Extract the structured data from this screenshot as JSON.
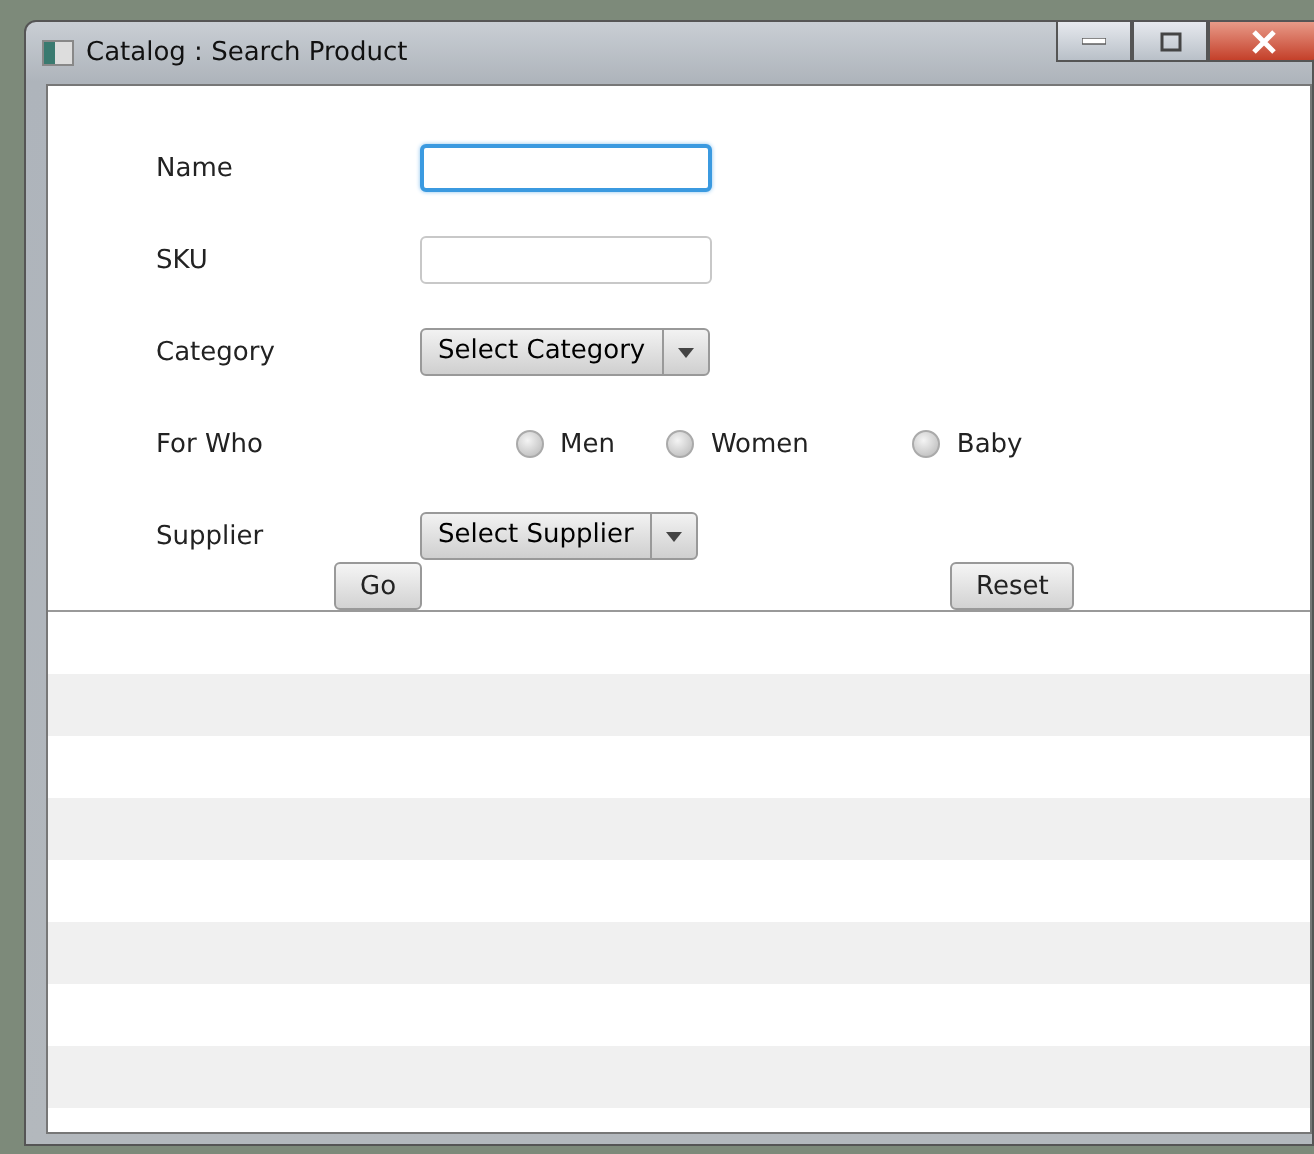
{
  "window": {
    "title": "Catalog : Search Product"
  },
  "form": {
    "name": {
      "label": "Name",
      "focused": true
    },
    "sku": {
      "label": "SKU",
      "focused": false
    },
    "category": {
      "label": "Category",
      "placeholder": "Select Category"
    },
    "for_who": {
      "label": "For Who",
      "options": [
        {
          "label": "Men",
          "selected": false
        },
        {
          "label": "Women",
          "selected": false
        },
        {
          "label": "Baby",
          "selected": false
        }
      ]
    },
    "supplier": {
      "label": "Supplier",
      "placeholder": "Select Supplier"
    }
  },
  "buttons": [
    {
      "label": "Go"
    },
    {
      "label": "Reset"
    }
  ]
}
